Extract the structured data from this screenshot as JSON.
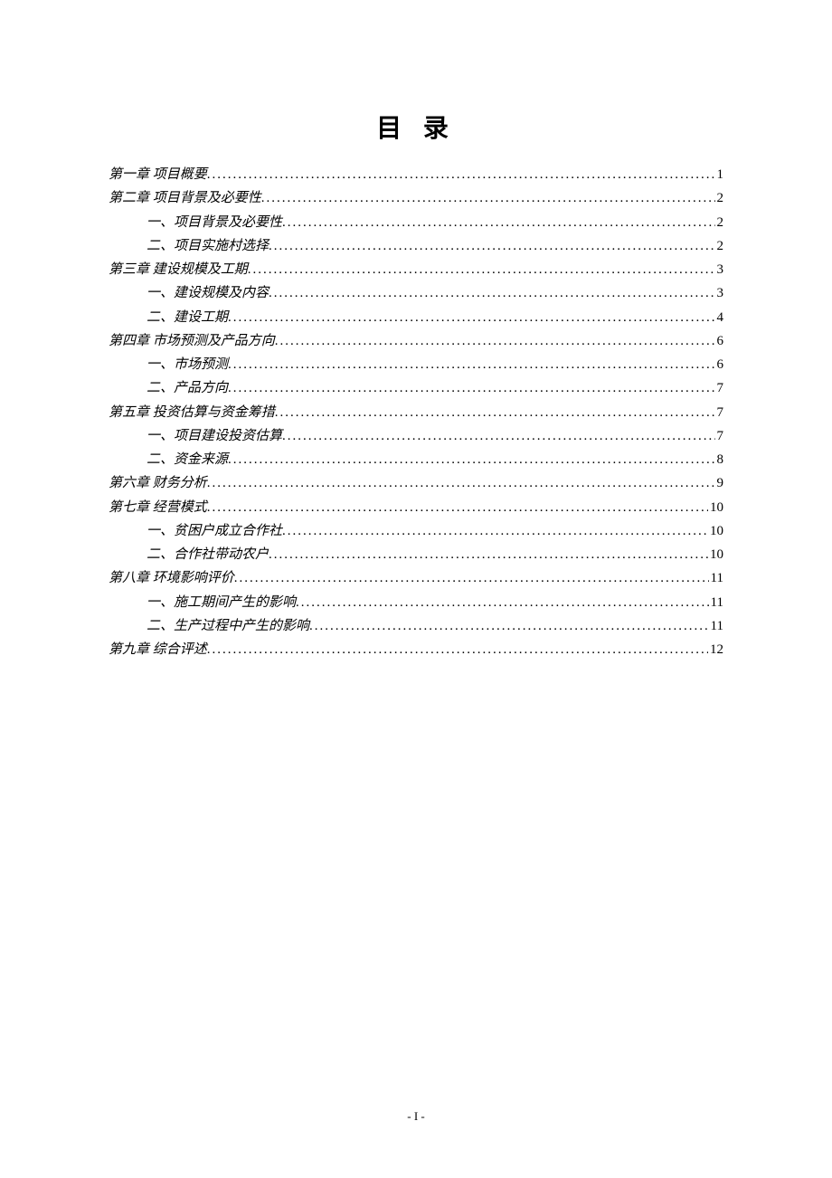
{
  "title": "目 录",
  "footer": "- I -",
  "toc": [
    {
      "level": "chapter",
      "chapter": "第一章",
      "text": "项目概要",
      "page": "1"
    },
    {
      "level": "chapter",
      "chapter": "第二章",
      "text": "项目背景及必要性",
      "page": "2"
    },
    {
      "level": "sub",
      "chapter": "一、",
      "text": "项目背景及必要性",
      "page": "2",
      "trailing_space": true
    },
    {
      "level": "sub",
      "chapter": "二、",
      "text": "项目实施村选择",
      "page": "2",
      "trailing_space": true
    },
    {
      "level": "chapter",
      "chapter": "第三章",
      "text": "建设规模及工期",
      "page": "3"
    },
    {
      "level": "sub",
      "chapter": "一、",
      "text": "建设规模及内容",
      "page": "3",
      "trailing_space": true
    },
    {
      "level": "sub",
      "chapter": "二、",
      "text": "建设工期",
      "page": "4",
      "trailing_space": true
    },
    {
      "level": "chapter",
      "chapter": "第四章",
      "text": "市场预测及产品方向",
      "page": "6"
    },
    {
      "level": "sub",
      "chapter": "一、",
      "text": "市场预测",
      "page": "6",
      "trailing_space": true
    },
    {
      "level": "sub",
      "chapter": "二、",
      "text": "产品方向",
      "page": "7",
      "trailing_space": true
    },
    {
      "level": "chapter",
      "chapter": "第五章",
      "text": "投资估算与资金筹措",
      "page": "7"
    },
    {
      "level": "sub",
      "chapter": "一、",
      "text": "项目建设投资估算",
      "page": "7",
      "trailing_space": true
    },
    {
      "level": "sub",
      "chapter": "二、",
      "text": "资金来源",
      "page": "8",
      "trailing_space": true
    },
    {
      "level": "chapter",
      "chapter": "第六章",
      "text": "财务分析",
      "page": "9"
    },
    {
      "level": "chapter",
      "chapter": "第七章",
      "text": "经营模式",
      "page": "10"
    },
    {
      "level": "sub",
      "chapter": "一、",
      "text": "贫困户成立合作社",
      "page": "10",
      "trailing_space": true
    },
    {
      "level": "sub",
      "chapter": "二、",
      "text": "合作社带动农户",
      "page": "10",
      "trailing_space": true
    },
    {
      "level": "chapter",
      "chapter": "第八章",
      "text": "环境影响评价",
      "page": "11"
    },
    {
      "level": "sub",
      "chapter": "一、",
      "text": "施工期间产生的影响",
      "page": "11",
      "trailing_space": true
    },
    {
      "level": "sub",
      "chapter": "二、",
      "text": "生产过程中产生的影响",
      "page": "11",
      "trailing_space": true
    },
    {
      "level": "chapter",
      "chapter": "第九章",
      "text": "综合评述",
      "page": "12"
    }
  ]
}
